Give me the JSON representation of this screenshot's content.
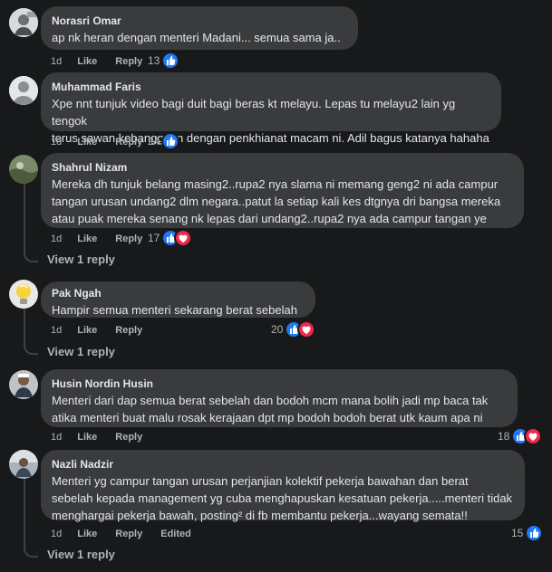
{
  "comments": [
    {
      "author": "Norasri Omar",
      "text": "ap nk heran dengan menteri Madani... semua sama ja..",
      "age": "1d",
      "like": "Like",
      "reply": "Reply",
      "edited": "",
      "count": "13",
      "reactions": [
        "like"
      ],
      "view_reply": ""
    },
    {
      "author": "Muhammad Faris",
      "text": "Xpe nnt tunjuk video bagi duit bagi beras kt melayu. Lepas tu melayu2 lain yg tengok\nterus sawan kebanggaan dengan penkhianat macam ni. Adil bagus katanya hahaha",
      "age": "1d",
      "like": "Like",
      "reply": "Reply",
      "edited": "",
      "count": "24",
      "reactions": [
        "like"
      ],
      "view_reply": ""
    },
    {
      "author": "Shahrul Nizam",
      "text": "Mereka dh tunjuk belang masing2..rupa2 nya slama ni memang geng2 ni ada campur\ntangan urusan undang2 dlm negara..patut la setiap kali kes dtgnya dri bangsa mereka\natau puak mereka senang nk lepas dari undang2..rupa2 nya ada campur tangan ye",
      "age": "1d",
      "like": "Like",
      "reply": "Reply",
      "edited": "",
      "count": "17",
      "reactions": [
        "like",
        "love"
      ],
      "view_reply": "View 1 reply"
    },
    {
      "author": "Pak Ngah",
      "text": "Hampir semua menteri sekarang berat sebelah",
      "age": "1d",
      "like": "Like",
      "reply": "Reply",
      "edited": "",
      "count": "20",
      "reactions": [
        "like",
        "love"
      ],
      "view_reply": "View 1 reply"
    },
    {
      "author": "Husin Nordin Husin",
      "text": "Menteri dari dap semua berat sebelah dan bodoh mcm mana bolih jadi mp baca tak\natika menteri buat malu rosak kerajaan dpt mp bodoh bodoh berat utk kaum apa ni",
      "age": "1d",
      "like": "Like",
      "reply": "Reply",
      "edited": "",
      "count": "18",
      "reactions": [
        "like",
        "love"
      ],
      "view_reply": ""
    },
    {
      "author": "Nazli Nadzir",
      "text": "Menteri yg campur tangan urusan perjanjian kolektif pekerja bawahan dan berat\nsebelah kepada management yg cuba menghapuskan kesatuan pekerja.....menteri tidak\nmenghargai pekerja bawah, posting² di fb membantu pekerja...wayang semata!!",
      "age": "1d",
      "like": "Like",
      "reply": "Reply",
      "edited": "Edited",
      "count": "15",
      "reactions": [
        "like"
      ],
      "view_reply": "View 1 reply"
    }
  ],
  "colors": {
    "background": "#18191a",
    "bubble": "#3a3b3c",
    "like": "#2078f4",
    "love": "#f0284a"
  }
}
